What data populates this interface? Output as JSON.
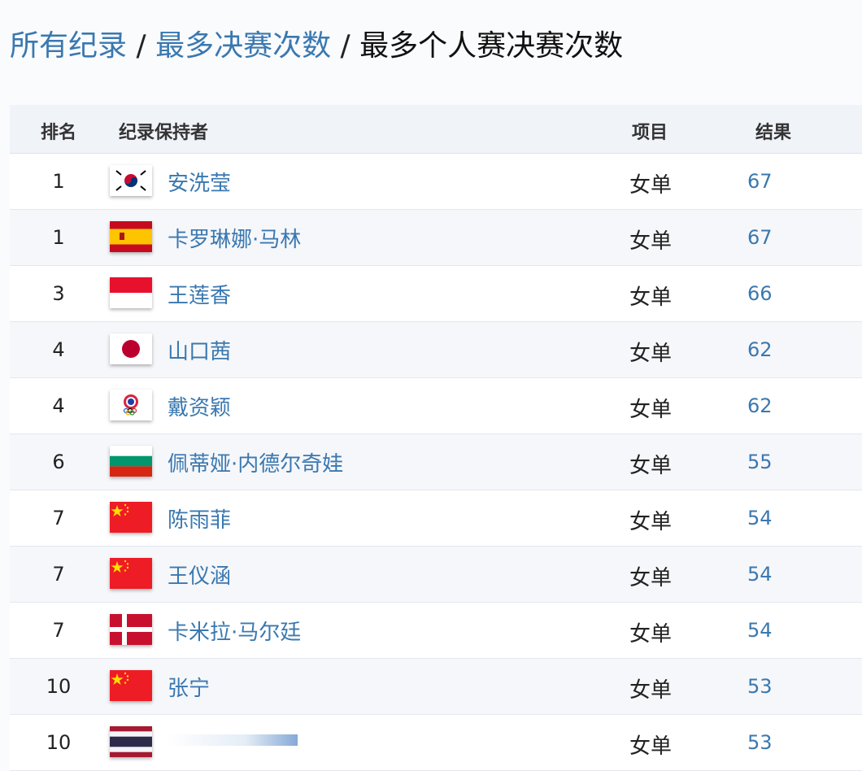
{
  "breadcrumb": {
    "crumb1": "所有纪录",
    "sep": "/",
    "crumb2": "最多决赛次数",
    "current": "最多个人赛决赛次数"
  },
  "table": {
    "headers": {
      "rank": "排名",
      "holder": "纪录保持者",
      "event": "项目",
      "result": "结果"
    },
    "rows": [
      {
        "rank": "1",
        "flag": "korea-flag-icon",
        "name": "安洗莹",
        "event": "女单",
        "result": "67"
      },
      {
        "rank": "1",
        "flag": "spain-flag-icon",
        "name": "卡罗琳娜·马林",
        "event": "女单",
        "result": "67"
      },
      {
        "rank": "3",
        "flag": "indonesia-flag-icon",
        "name": "王莲香",
        "event": "女单",
        "result": "66"
      },
      {
        "rank": "4",
        "flag": "japan-flag-icon",
        "name": "山口茜",
        "event": "女单",
        "result": "62"
      },
      {
        "rank": "4",
        "flag": "chinese-taipei-flag-icon",
        "name": "戴资颖",
        "event": "女单",
        "result": "62"
      },
      {
        "rank": "6",
        "flag": "bulgaria-flag-icon",
        "name": "佩蒂娅·内德尔奇娃",
        "event": "女单",
        "result": "55"
      },
      {
        "rank": "7",
        "flag": "china-flag-icon",
        "name": "陈雨菲",
        "event": "女单",
        "result": "54"
      },
      {
        "rank": "7",
        "flag": "china-flag-icon",
        "name": "王仪涵",
        "event": "女单",
        "result": "54"
      },
      {
        "rank": "7",
        "flag": "denmark-flag-icon",
        "name": "卡米拉·马尔廷",
        "event": "女单",
        "result": "54"
      },
      {
        "rank": "10",
        "flag": "china-flag-icon",
        "name": "张宁",
        "event": "女单",
        "result": "53"
      },
      {
        "rank": "10",
        "flag": "thailand-flag-icon",
        "name": "",
        "event": "女单",
        "result": "53"
      }
    ]
  },
  "colors": {
    "link": "#3a78b0",
    "header_bg": "#f0f3f8"
  }
}
